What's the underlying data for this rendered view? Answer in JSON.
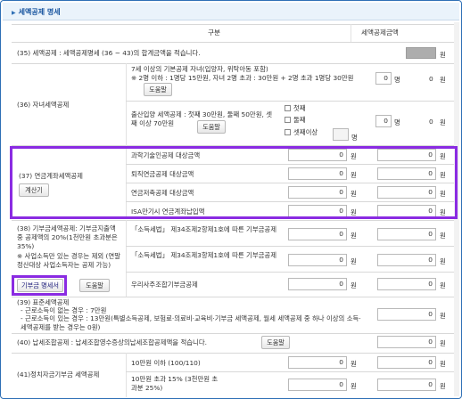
{
  "section": {
    "title": "세액공제 명세"
  },
  "header": {
    "col_item": "구분",
    "col_amount": "세액공제금액"
  },
  "r35": {
    "label": "(35) 세액공제 : 세액공제명세 (36 ~ 43)의 합계금액을 적습니다.",
    "unit": "원"
  },
  "r36": {
    "label": "(36) 자녀세액공제",
    "child_line1": "7세 이상의 기본공제 자녀(입양자, 위탁아동 포함)",
    "child_line2": "※ 2명 이하 : 1명당 15만원, 자녀 2명 초과 : 30만원 + 2명 초과 1명당 30만원",
    "help": "도움말",
    "child_count": "0",
    "count_unit": "명",
    "child_amount": "0",
    "unit": "원",
    "birth_line1": "출산입양 세액공제 : 첫째 30만원, 둘째 50만원, 셋째 이상 70만원",
    "cb1": "첫째",
    "cb2": "둘째",
    "cb3": "셋째이상",
    "birth_count": "0",
    "birth_amount": "0"
  },
  "r37": {
    "label": "(37) 연금계좌세액공제",
    "calc_button": "계산기",
    "rows": [
      {
        "label": "과학기술인공제 대상금액",
        "base": "0",
        "credit": "0"
      },
      {
        "label": "퇴직연금공제 대상금액",
        "base": "0",
        "credit": "0"
      },
      {
        "label": "연금저축공제 대상금액",
        "base": "0",
        "credit": "0"
      },
      {
        "label": "ISA만기시 연금계좌납입액",
        "base": "0",
        "credit": "0"
      }
    ],
    "unit": "원"
  },
  "r38": {
    "label": "(38) 기부금세액공제: 기부금지출액 중 공제액의 20%(1천만원 초과분은 35%)",
    "note": "※ 사업소득만 있는 경우는 제외 (연말정산대상 사업소득자는 공제 가능)",
    "statement_button": "기부금 명세서",
    "help": "도움말",
    "rows": [
      {
        "label": "「소득세법」 제34조제2항제1호에 따른 기부금공제",
        "base": "0",
        "credit": "0"
      },
      {
        "label": "「소득세법」 제34조제3항제1호에 따른 기부금공제",
        "base": "0",
        "credit": "0"
      },
      {
        "label": "우리사주조합기부금공제",
        "base": "0",
        "credit": "0"
      }
    ],
    "unit": "원"
  },
  "r39": {
    "label": "(39) 표준세액공제",
    "line1": "- 근로소득이 없는 경우 : 7만원",
    "line2": "- 근로소득이 있는 경우 : 13만원(특별소득공제, 보험료·의료비·교육비·기부금 세액공제, 월세 세액공제 중 하나 이상의 소득·세액공제를 받는 경우는 0원)",
    "amount": "0",
    "unit": "원"
  },
  "r40": {
    "label": "(40) 납세조합공제 : 납세조합영수증상의납세조합공제액을 적습니다.",
    "help": "도움말",
    "amount": "0",
    "unit": "원"
  },
  "r41": {
    "label": "(41)정치자금기부금 세액공제",
    "rows": [
      {
        "label": "10만원 이하 (100/110)",
        "base": "0",
        "credit": "0"
      },
      {
        "label": "10만원 초과 15% (3천만원 초과분 25%)",
        "base": "0",
        "credit": "0"
      }
    ],
    "unit": "원"
  }
}
